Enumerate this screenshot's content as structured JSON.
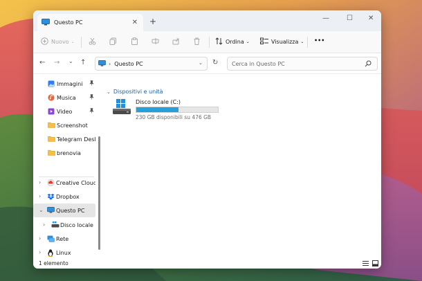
{
  "window": {
    "tab_title": "Questo PC",
    "new_tab_glyph": "+",
    "tab_close_glyph": "✕",
    "minimize_glyph": "—",
    "maximize_glyph": "☐",
    "close_glyph": "✕"
  },
  "toolbar": {
    "new_label": "Nuovo",
    "sort_label": "Ordina",
    "view_label": "Visualizza",
    "more_glyph": "•••"
  },
  "nav": {
    "back": "←",
    "forward": "→",
    "recent": "⌄",
    "up": "↑",
    "refresh": "↻"
  },
  "address": {
    "breadcrumb": "Questo PC",
    "separator": "›",
    "dropdown": "⌄"
  },
  "search": {
    "placeholder": "Cerca in Questo PC"
  },
  "sidebar": {
    "pinned": [
      {
        "label": "Immagini",
        "icon": "pictures-icon",
        "pinned": true
      },
      {
        "label": "Musica",
        "icon": "music-icon",
        "pinned": true
      },
      {
        "label": "Video",
        "icon": "video-icon",
        "pinned": true
      },
      {
        "label": "Screenshot",
        "icon": "folder-icon",
        "pinned": false
      },
      {
        "label": "Telegram Deskto",
        "icon": "folder-icon",
        "pinned": false
      },
      {
        "label": "brenovia",
        "icon": "folder-icon",
        "pinned": false
      }
    ],
    "tree": [
      {
        "label": "Creative Cloud Fi",
        "icon": "creative-cloud-icon"
      },
      {
        "label": "Dropbox",
        "icon": "dropbox-icon"
      },
      {
        "label": "Questo PC",
        "icon": "computer-icon"
      },
      {
        "label": "Disco locale (C:",
        "icon": "drive-icon"
      },
      {
        "label": "Rete",
        "icon": "network-icon"
      },
      {
        "label": "Linux",
        "icon": "linux-icon"
      }
    ],
    "chevron_right": "›",
    "chevron_down": "⌄"
  },
  "content": {
    "group_title": "Dispositivi e unità",
    "drive": {
      "name": "Disco locale (C:)",
      "free_text": "230 GB disponibili su 476 GB",
      "used_fraction": 0.517
    }
  },
  "status": {
    "count": "1 elemento"
  },
  "colors": {
    "accent": "#26a0da",
    "selection": "#e5e5e5",
    "link": "#1b5fa8"
  }
}
